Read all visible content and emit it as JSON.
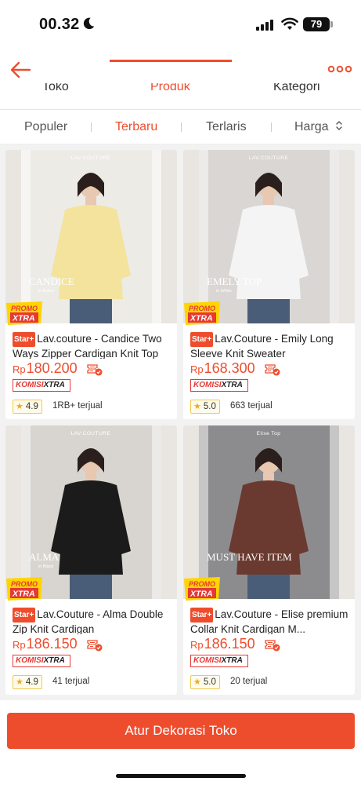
{
  "status_bar": {
    "time": "00.32",
    "battery": "79"
  },
  "header": {
    "tabs": [
      {
        "label": "Toko"
      },
      {
        "label": "Produk"
      },
      {
        "label": "Kategori"
      }
    ],
    "active_tab": "Produk"
  },
  "sort_bar": {
    "items": [
      {
        "label": "Populer"
      },
      {
        "label": "Terbaru"
      },
      {
        "label": "Terlaris"
      },
      {
        "label": "Harga"
      }
    ],
    "active": "Terbaru"
  },
  "badges": {
    "star_plus": "Star+",
    "promo_top": "PROMO",
    "promo_bottom": "XTRA",
    "komisi": "KOMISI",
    "komisi_xtra": "XTRA"
  },
  "currency": "Rp",
  "products": [
    {
      "title": "Lav.couture - Candice Two Ways Zipper Cardigan Knit Top",
      "price": "180.200",
      "rating": "4.9",
      "sold": "1RB+ terjual",
      "image": {
        "brand": "LAV.COUTURE",
        "name": "CANDICE",
        "sub": "in Butter",
        "backdrop": "#ecebe6",
        "garment": "#f3e39d"
      }
    },
    {
      "title": "Lav.Couture - Emily Long Sleeve Knit Sweater",
      "price": "168.300",
      "rating": "5.0",
      "sold": "663 terjual",
      "image": {
        "brand": "LAV.COUTURE",
        "name": "EMELY TOP",
        "sub": "in White",
        "backdrop": "#d9d6d3",
        "garment": "#f4f4f4"
      }
    },
    {
      "title": "Lav.Couture - Alma Double Zip Knit Cardigan",
      "price": "186.150",
      "rating": "4.9",
      "sold": "41 terjual",
      "image": {
        "brand": "LAV.COUTURE",
        "name": "ALMA",
        "sub": "in Black",
        "backdrop": "#d8d5d0",
        "garment": "#1b1b1b"
      }
    },
    {
      "title": "Lav.Couture - Elise premium Collar Knit Cardigan M...",
      "price": "186.150",
      "rating": "5.0",
      "sold": "20 terjual",
      "image": {
        "brand": "Elise Top",
        "name": "MUST HAVE ITEM",
        "sub": "",
        "backdrop": "#8c8c8e",
        "garment": "#6a3a30"
      }
    }
  ],
  "cta": {
    "label": "Atur Dekorasi Toko"
  },
  "colors": {
    "accent": "#ee4d2d",
    "star": "#f5a623",
    "komisi_red": "#e53935"
  }
}
